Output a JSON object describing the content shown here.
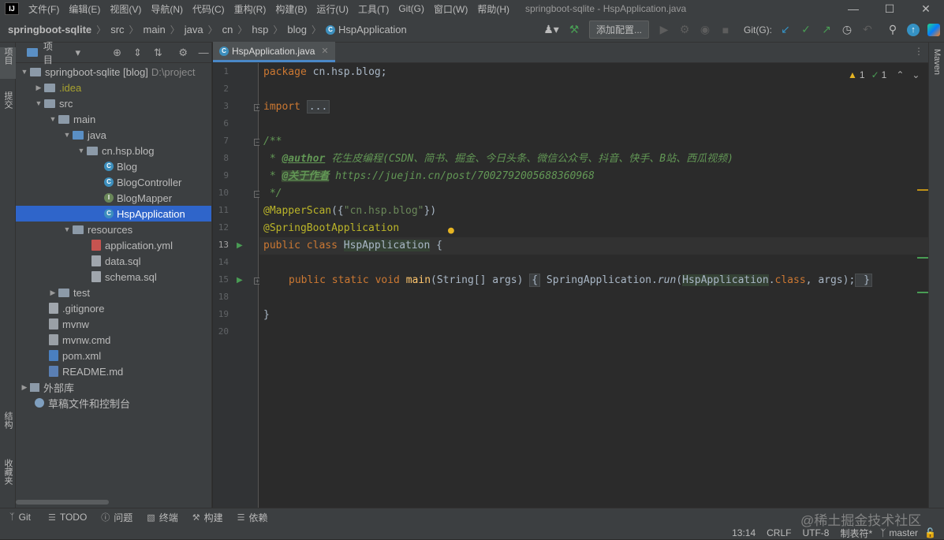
{
  "menubar": {
    "items": [
      "文件(F)",
      "编辑(E)",
      "视图(V)",
      "导航(N)",
      "代码(C)",
      "重构(R)",
      "构建(B)",
      "运行(U)",
      "工具(T)",
      "Git(G)",
      "窗口(W)",
      "帮助(H)"
    ],
    "window_title": "springboot-sqlite - HspApplication.java",
    "logo": "IJ"
  },
  "navbar": {
    "breadcrumbs": [
      "springboot-sqlite",
      "src",
      "main",
      "java",
      "cn",
      "hsp",
      "blog",
      "HspApplication"
    ],
    "add_config": "添加配置...",
    "git_label": "Git(G):"
  },
  "left_stripe": {
    "project_tab": "项目",
    "commit_tab": "提交",
    "structure_tab": "结构",
    "favorites_tab": "收藏夹"
  },
  "right_stripe": {
    "maven_tab": "Maven"
  },
  "project_panel": {
    "title": "项目",
    "tree": [
      {
        "label": "springboot-sqlite [blog]",
        "extra": "D:\\project",
        "depth": 0,
        "expanded": true,
        "icon": "folder-icon"
      },
      {
        "label": ".idea",
        "depth": 1,
        "expanded": false,
        "icon": "folder-icon",
        "color": "#a8a22f"
      },
      {
        "label": "src",
        "depth": 1,
        "expanded": true,
        "icon": "folder-icon"
      },
      {
        "label": "main",
        "depth": 2,
        "expanded": true,
        "icon": "folder-icon"
      },
      {
        "label": "java",
        "depth": 3,
        "expanded": true,
        "icon": "source-folder-icon"
      },
      {
        "label": "cn.hsp.blog",
        "depth": 4,
        "expanded": true,
        "icon": "package-icon"
      },
      {
        "label": "Blog",
        "depth": 5,
        "icon": "class-icon"
      },
      {
        "label": "BlogController",
        "depth": 5,
        "icon": "class-icon"
      },
      {
        "label": "BlogMapper",
        "depth": 5,
        "icon": "interface-icon"
      },
      {
        "label": "HspApplication",
        "depth": 5,
        "icon": "class-icon",
        "selected": true
      },
      {
        "label": "resources",
        "depth": 3,
        "expanded": true,
        "icon": "resources-folder-icon"
      },
      {
        "label": "application.yml",
        "depth": 4,
        "icon": "yml-file-icon"
      },
      {
        "label": "data.sql",
        "depth": 4,
        "icon": "sql-file-icon"
      },
      {
        "label": "schema.sql",
        "depth": 4,
        "icon": "sql-file-icon"
      },
      {
        "label": "test",
        "depth": 2,
        "expanded": false,
        "icon": "folder-icon"
      },
      {
        "label": ".gitignore",
        "depth": 1,
        "icon": "gitignore-file-icon"
      },
      {
        "label": "mvnw",
        "depth": 1,
        "icon": "script-file-icon"
      },
      {
        "label": "mvnw.cmd",
        "depth": 1,
        "icon": "cmd-file-icon"
      },
      {
        "label": "pom.xml",
        "depth": 1,
        "icon": "maven-file-icon"
      },
      {
        "label": "README.md",
        "depth": 1,
        "icon": "md-file-icon"
      },
      {
        "label": "外部库",
        "depth": 0,
        "expanded": false,
        "icon": "library-icon"
      },
      {
        "label": "草稿文件和控制台",
        "depth": 0,
        "icon": "scratch-icon"
      }
    ]
  },
  "editor": {
    "tab_label": "HspApplication.java",
    "inspections": {
      "warnings": "1",
      "ok": "1"
    },
    "line_numbers": [
      "1",
      "2",
      "3",
      "6",
      "7",
      "8",
      "9",
      "10",
      "11",
      "12",
      "13",
      "14",
      "15",
      "18",
      "19",
      "20"
    ],
    "code": {
      "l1_kw": "package",
      "l1_rest": " cn.hsp.blog;",
      "l3_kw": "import",
      "l3_fold": "...",
      "l7": "/**",
      "l8_star": " * ",
      "l8_tag": "@author",
      "l8_text": " 花生皮编程(CSDN、简书、掘金、今日头条、微信公众号、抖音、快手、B站、西瓜视频)",
      "l9_star": " * ",
      "l9_tag": "@关于作者",
      "l9_text": " https://juejin.cn/post/7002792005688360968",
      "l10": " */",
      "l11_ann": "@MapperScan",
      "l11_a": "({",
      "l11_str": "\"cn.hsp.blog\"",
      "l11_b": "})",
      "l12_ann": "@SpringBootApplication",
      "l13_kw": "public class ",
      "l13_cls": "HspApplication",
      "l13_rest": " {",
      "l15_kw": "public static void ",
      "l15_fn": "main",
      "l15_a": "(String[] args) ",
      "l15_b1": "{",
      "l15_c": " SpringApplication.",
      "l15_run": "run",
      "l15_d": "(",
      "l15_cls": "HspApplication",
      "l15_e": ".",
      "l15_class": "class",
      "l15_f": ", args);",
      "l15_b2": " }",
      "l19": "}"
    }
  },
  "toolwindows": [
    "Git",
    "TODO",
    "问题",
    "终端",
    "构建",
    "依赖"
  ],
  "status": {
    "position": "13:14",
    "line_sep": "CRLF",
    "encoding": "UTF-8",
    "indent": "制表符*",
    "branch": "master"
  },
  "watermark": "@稀土掘金技术社区",
  "colors": {
    "accent": "#2f65ca",
    "keyword": "#cc7832",
    "annotation": "#bbb529",
    "string": "#6a8759",
    "run_icon": "#499c54"
  }
}
